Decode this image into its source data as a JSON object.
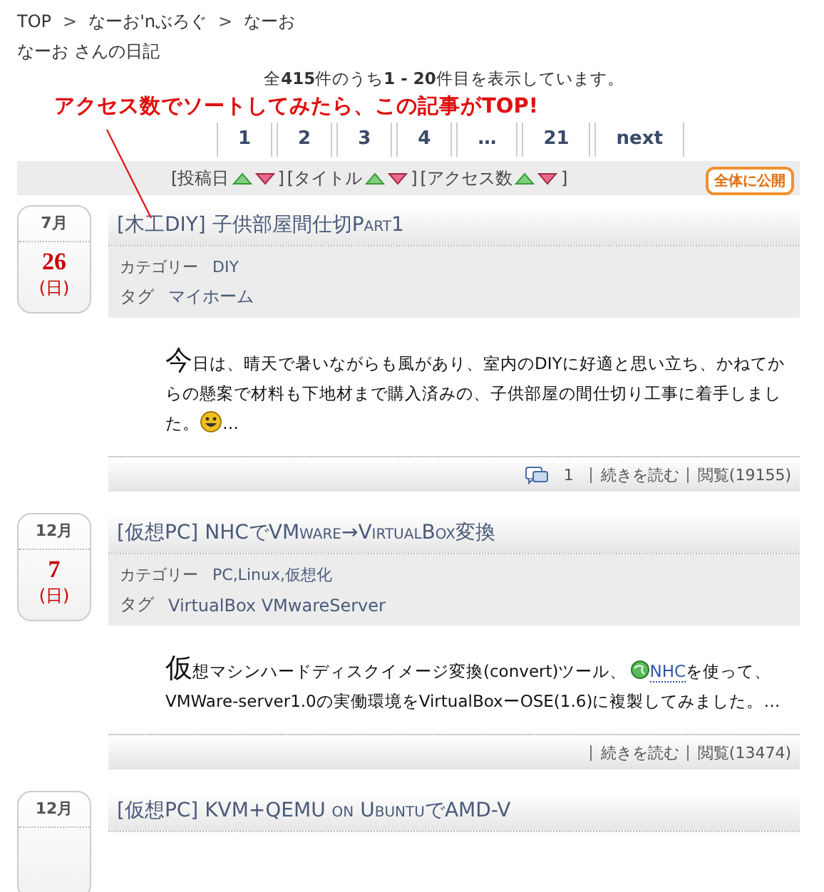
{
  "breadcrumb": [
    {
      "kind": "link",
      "text": "TOP"
    },
    {
      "kind": "separator",
      "text": ">"
    },
    {
      "kind": "link",
      "text": "なーお'nぶろぐ"
    },
    {
      "kind": "separator",
      "text": ">"
    },
    {
      "kind": "link",
      "text": "なーお"
    }
  ],
  "diary_title": "なーお さんの日記",
  "summary": "全**415**件のうち**1 - 20**件目を表示しています。",
  "annotation": "アクセス数でソートしてみたら、この記事がTOP!",
  "pagination": [
    "1",
    "2",
    "3",
    "4",
    "…",
    "21",
    "next"
  ],
  "sort_bar": {
    "fields": [
      {
        "label": "[投稿日",
        "end": "]"
      },
      {
        "label": "[タイトル",
        "end": "]"
      },
      {
        "label": "[アクセス数",
        "end": "]"
      }
    ],
    "badge": "全体に公開"
  },
  "entries": [
    {
      "month": "7月",
      "day": "26",
      "weekday": "(日)",
      "color": "#cc0000",
      "title": "[木工DIY] 子供部屋間仕切Part1",
      "category_label": "カテゴリー",
      "category": "DIY",
      "tag_label": "タグ",
      "tags": "マイホーム",
      "excerpt": [
        {
          "kind": "initial",
          "text": "今"
        },
        {
          "kind": "text",
          "text": "日は、晴天で暑いながらも風があり、室内のDIYに好適と思い立ち、かねてからの懸案で材料も下地材まで購入済みの、子供部屋の間仕切り工事に着手しました。"
        },
        {
          "kind": "smiley"
        },
        {
          "kind": "text",
          "text": "…"
        }
      ],
      "comments": "1",
      "read_more": "続きを読む",
      "views": "閲覧(19155)"
    },
    {
      "month": "12月",
      "day": "7",
      "weekday": "(日)",
      "color": "#cc0000",
      "title": "[仮想PC] NHCでVMware→VirtualBox変換",
      "category_label": "カテゴリー",
      "category": "PC,Linux,仮想化",
      "tag_label": "タグ",
      "tags": "VirtualBox VMwareServer",
      "excerpt": [
        {
          "kind": "initial",
          "text": "仮"
        },
        {
          "kind": "text",
          "text": "想マシンハードディスクイメージ変換(convert)ツール、"
        },
        {
          "kind": "link",
          "text": "NHC"
        },
        {
          "kind": "text",
          "text": "を使って、VMWare-server1.0の実働環境をVirtualBoxーOSE(1.6)に複製してみました。…"
        }
      ],
      "read_more": "続きを読む",
      "views": "閲覧(13474)"
    },
    {
      "month": "12月",
      "title": "[仮想PC] KVM+QEMU on UbuntuでAMD-V"
    }
  ]
}
